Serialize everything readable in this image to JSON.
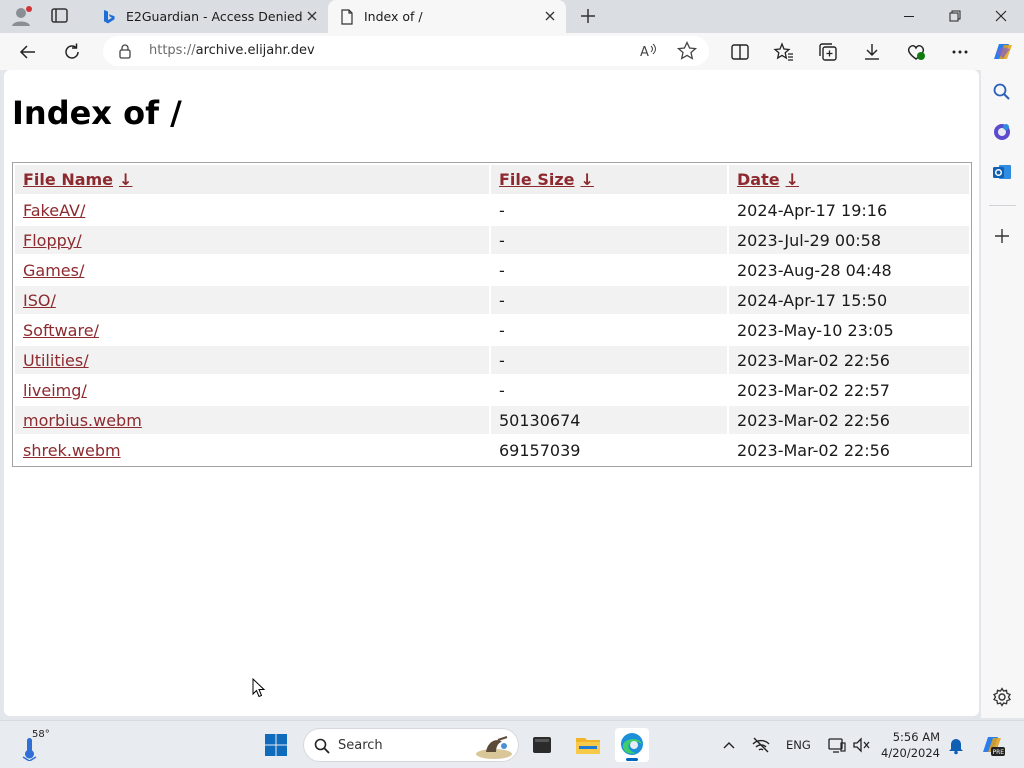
{
  "browser": {
    "tabs": [
      {
        "title": "E2Guardian - Access Denied",
        "active": false
      },
      {
        "title": "Index of /",
        "active": true
      }
    ],
    "address": {
      "protocol": "https://",
      "host": "archive.elijahr.dev"
    }
  },
  "page": {
    "heading": "Index of /",
    "columns": [
      {
        "label": "File Name",
        "arrow": "↓"
      },
      {
        "label": "File Size",
        "arrow": "↓"
      },
      {
        "label": "Date",
        "arrow": "↓"
      }
    ],
    "rows": [
      {
        "name": "FakeAV",
        "slash": "/",
        "size": "-",
        "date": "2024-Apr-17 19:16"
      },
      {
        "name": "Floppy",
        "slash": "/",
        "size": "-",
        "date": "2023-Jul-29 00:58"
      },
      {
        "name": "Games",
        "slash": "/",
        "size": "-",
        "date": "2023-Aug-28 04:48"
      },
      {
        "name": "ISO",
        "slash": "/",
        "size": "-",
        "date": "2024-Apr-17 15:50"
      },
      {
        "name": "Software",
        "slash": "/",
        "size": "-",
        "date": "2023-May-10 23:05"
      },
      {
        "name": "Utilities",
        "slash": "/",
        "size": "-",
        "date": "2023-Mar-02 22:56"
      },
      {
        "name": "liveimg",
        "slash": "/",
        "size": "-",
        "date": "2023-Mar-02 22:57"
      },
      {
        "name": "morbius.webm",
        "slash": "",
        "size": "50130674",
        "date": "2023-Mar-02 22:56"
      },
      {
        "name": "shrek.webm",
        "slash": "",
        "size": "69157039",
        "date": "2023-Mar-02 22:56"
      }
    ]
  },
  "taskbar": {
    "weather_temp": "58°",
    "search_placeholder": "Search",
    "language": "ENG",
    "time": "5:56 AM",
    "date": "4/20/2024"
  },
  "colors": {
    "link": "#8d2a2f",
    "accent": "#0067c0",
    "row_alt": "#f2f2f2"
  },
  "icons": [
    "profile-icon",
    "tab-actions-icon",
    "bing-icon",
    "page-icon",
    "close-icon",
    "new-tab-icon",
    "minimize-icon",
    "restore-icon",
    "back-icon",
    "refresh-icon",
    "lock-icon",
    "read-aloud-icon",
    "favorite-star-icon",
    "split-screen-icon",
    "favorites-icon",
    "collections-icon",
    "download-icon",
    "performance-icon",
    "more-icon",
    "copilot-icon",
    "search-icon",
    "office-icon",
    "outlook-icon",
    "add-icon",
    "settings-icon",
    "windows-start-icon",
    "file-manager-icon",
    "file-explorer-icon",
    "edge-icon",
    "chevron-up-icon",
    "network-icon",
    "display-icon",
    "volume-icon",
    "bell-icon",
    "copilot-pre-icon"
  ]
}
